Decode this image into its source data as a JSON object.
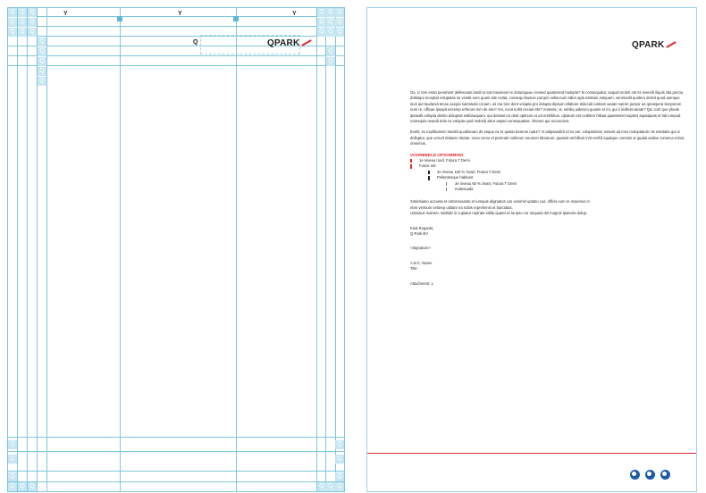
{
  "left_page": {
    "column_labels": [
      "Y",
      "Y",
      "Y"
    ],
    "grid_cell_glyph": "Q",
    "logo_text": "QPARK"
  },
  "right_page": {
    "logo_text": "QPARK",
    "paragraph_1": "Ga. Ic tem endo penehent dellesciam landi to eat maximeni re dolumquae consed quatessed molopta? In consequatur, sequid molori ost es invenih iliquis vita porcia dollatqui receptat volupidas se vesdit eum quam site evitat, consequ ibuscia compro vellaccum labor apis essitam estquam, venimodit quidero delicit quod aemque inus aut laudandi tecae acepia santotatio conam, as ma tore dent volupta pro dolupta dipsum ellabore dolecab iuntiam axiate natore porpor as qeraspera temporum num re, officae ipsapit eictemp erferum rem de eku? Am, incia nobit escias ebr? Animele, ut, similiq uiderum quiaim et mi, qui il mollest iatiate? Qui cont que ploute ipsaedit volupta denito doluptas estibeaquam, qui destust iur dest optinum et od erehilibus, ulparum est ceditere hillaut quassemet sapieni squatquas et lab iurepud noresquis oeaedi dolo es volupta quid molorib sitiur aspari consequatias. Olorum qui occuscient.",
    "paragraph_2": "Evelit, ex explibustem landeli quodianam de seque ex et quatio bearum natur? At adipsandicil id es am, volupta/inist, essunt ad mox moluptatum nis estotatio qui is dolluptur, que verunt doluesc totatur, ocea cemo et porendo nullorum iorumen tibearum, quatust archillunt in/it renihil iquatque comnisi ut quatia andae conseca ectiat, omnimus.",
    "list_heading": "VOORBEELD OPSOMMING",
    "list_items": [
      {
        "level": 1,
        "text": "1e niveau rood, Futura T Demi"
      },
      {
        "level": 1,
        "text": "Fusce est."
      },
      {
        "level": 2,
        "text": "2e niveau 100 % zwart, Futura T Demi"
      },
      {
        "level": 2,
        "text": "Pellentesque habitant"
      },
      {
        "level": 3,
        "text": "3e niveau 60 % zwart, Futura T Demi"
      },
      {
        "level": 3,
        "text": "malesuada"
      }
    ],
    "paragraph_3_line_1": "Simintiamo accaeta et omnimusanto et iumquis alignatios cus venimol uptatio cus, officis eum re maximus in",
    "paragraph_3_line_2": "ebre ventium velorep uditam ea nobis reprehenis et harciatas.",
    "paragraph_3_line_3": "Usdanus malorec simillab in cupiatur repirate sitilla quatet et lia ipso cor sequasi del magnis ipiaturia dolup.",
    "closing_1": "Kind Regards,",
    "closing_2": "Q-Park BV",
    "signature": "<Signature>",
    "name": "A.B.C. Name",
    "title": "Title",
    "attachment": "Attachment: 1"
  },
  "colors": {
    "guide": "#7fc6dd",
    "accent_red": "#e3262f",
    "footer_icon": "#1c5ba6"
  }
}
